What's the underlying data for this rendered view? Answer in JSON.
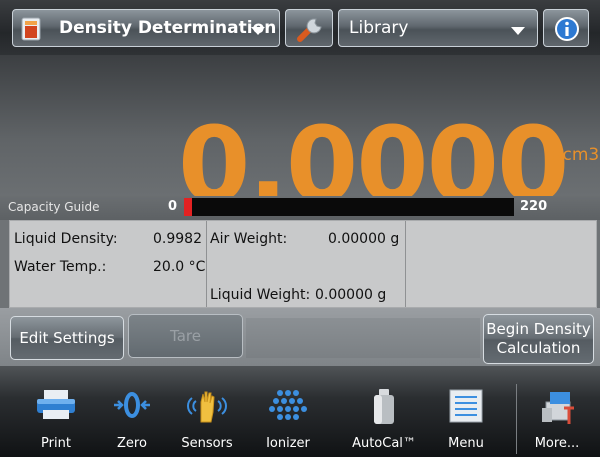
{
  "header": {
    "application_label": "Density Determination",
    "library_label": "Library"
  },
  "display": {
    "weight_value": "0.0000",
    "unit": "g/cm3"
  },
  "capacity_guide": {
    "label": "Capacity Guide",
    "min": "0",
    "max": "220",
    "level_fraction": 0.02
  },
  "results": {
    "liquid_density_label": "Liquid Density:",
    "liquid_density_value": "0.9982",
    "water_temp_label": "Water Temp.:",
    "water_temp_value": "20.0 °C",
    "air_weight_label": "Air Weight:",
    "air_weight_value": "0.00000 g",
    "liquid_weight_label": "Liquid Weight:",
    "liquid_weight_value": "0.00000 g"
  },
  "actions": {
    "edit_settings": "Edit Settings",
    "tare": "Tare",
    "begin_line1": "Begin Density",
    "begin_line2": "Calculation"
  },
  "toolbar": {
    "print": "Print",
    "zero": "Zero",
    "sensors": "Sensors",
    "ionizer": "Ionizer",
    "autocal": "AutoCal™",
    "menu": "Menu",
    "more": "More..."
  },
  "colors": {
    "weight": "#e8902a",
    "capacity_fill": "#e32222"
  }
}
